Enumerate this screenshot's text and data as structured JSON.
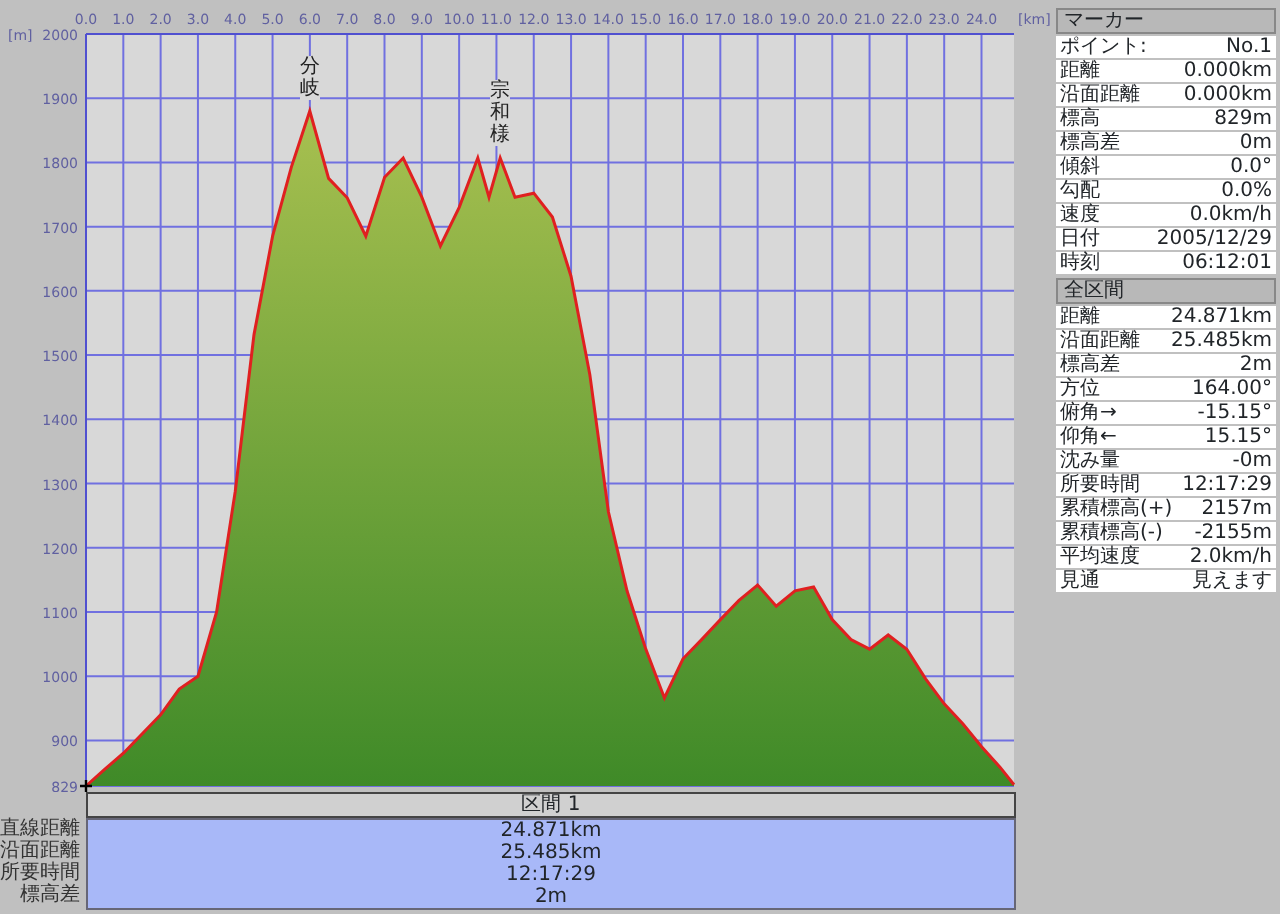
{
  "chart": {
    "y_unit": "[m]",
    "x_unit": "[km]",
    "chart_data": {
      "type": "area",
      "x": [
        0,
        0.5,
        1,
        1.5,
        2,
        2.5,
        3,
        3.5,
        4,
        4.5,
        5,
        5.5,
        6,
        6.5,
        7,
        7.5,
        8,
        8.5,
        9,
        9.5,
        10,
        10.5,
        10.8,
        11.1,
        11.5,
        12,
        12.5,
        13,
        13.5,
        14,
        14.5,
        15,
        15.5,
        16,
        16.5,
        17,
        17.5,
        18,
        18.5,
        19,
        19.5,
        20,
        20.5,
        21,
        21.5,
        22,
        22.5,
        23,
        23.5,
        24,
        24.5,
        24.871
      ],
      "grid": true,
      "series": [
        {
          "color": "#e02020",
          "values": [
            829,
            855,
            880,
            910,
            940,
            980,
            1000,
            1100,
            1287,
            1532,
            1685,
            1792,
            1880,
            1775,
            1745,
            1685,
            1777,
            1807,
            1746,
            1670,
            1730,
            1807,
            1746,
            1807,
            1746,
            1752,
            1715,
            1623,
            1470,
            1256,
            1133,
            1043,
            966,
            1027,
            1057,
            1088,
            1118,
            1142,
            1109,
            1133,
            1139,
            1088,
            1057,
            1042,
            1064,
            1042,
            996,
            957,
            926,
            890,
            858,
            831
          ]
        }
      ],
      "xlim": [
        0,
        24.871
      ],
      "ylim": [
        829,
        2000
      ],
      "xticks": [
        {
          "value": 0,
          "label": "0.0"
        },
        {
          "value": 1,
          "label": "1.0"
        },
        {
          "value": 2,
          "label": "2.0"
        },
        {
          "value": 3,
          "label": "3.0"
        },
        {
          "value": 4,
          "label": "4.0"
        },
        {
          "value": 5,
          "label": "5.0"
        },
        {
          "value": 6,
          "label": "6.0"
        },
        {
          "value": 7,
          "label": "7.0"
        },
        {
          "value": 8,
          "label": "8.0"
        },
        {
          "value": 9,
          "label": "9.0"
        },
        {
          "value": 10,
          "label": "10.0"
        },
        {
          "value": 11,
          "label": "11.0"
        },
        {
          "value": 12,
          "label": "12.0"
        },
        {
          "value": 13,
          "label": "13.0"
        },
        {
          "value": 14,
          "label": "14.0"
        },
        {
          "value": 15,
          "label": "15.0"
        },
        {
          "value": 16,
          "label": "16.0"
        },
        {
          "value": 17,
          "label": "17.0"
        },
        {
          "value": 18,
          "label": "18.0"
        },
        {
          "value": 19,
          "label": "19.0"
        },
        {
          "value": 20,
          "label": "20.0"
        },
        {
          "value": 21,
          "label": "21.0"
        },
        {
          "value": 22,
          "label": "22.0"
        },
        {
          "value": 23,
          "label": "23.0"
        },
        {
          "value": 24,
          "label": "24.0"
        }
      ],
      "yticks": [
        829,
        900,
        1000,
        1100,
        1200,
        1300,
        1400,
        1500,
        1600,
        1700,
        1800,
        1900,
        2000
      ],
      "annotations": [
        {
          "x": 6,
          "y": 1880,
          "text": "分岐"
        },
        {
          "x": 11.1,
          "y": 1807,
          "text": "宗和様"
        }
      ]
    }
  },
  "marker_panel": {
    "title": "マーカー",
    "rows": [
      {
        "label": "ポイント:",
        "value": "No.1"
      },
      {
        "label": "距離",
        "value": "0.000km"
      },
      {
        "label": "沿面距離",
        "value": "0.000km"
      },
      {
        "label": "標高",
        "value": "829m"
      },
      {
        "label": "標高差",
        "value": "0m"
      },
      {
        "label": "傾斜",
        "value": "0.0°"
      },
      {
        "label": "勾配",
        "value": "0.0%"
      },
      {
        "label": "速度",
        "value": "0.0km/h"
      },
      {
        "label": "日付",
        "value": "2005/12/29"
      },
      {
        "label": "時刻",
        "value": "06:12:01"
      }
    ]
  },
  "total_panel": {
    "title": "全区間",
    "rows": [
      {
        "label": "距離",
        "value": "24.871km"
      },
      {
        "label": "沿面距離",
        "value": "25.485km"
      },
      {
        "label": "標高差",
        "value": "2m"
      },
      {
        "label": "方位",
        "value": "164.00°"
      },
      {
        "label": "俯角→",
        "value": "-15.15°"
      },
      {
        "label": "仰角←",
        "value": "15.15°"
      },
      {
        "label": "沈み量",
        "value": "-0m"
      },
      {
        "label": "所要時間",
        "value": "12:17:29"
      },
      {
        "label": "累積標高(+)",
        "value": "2157m"
      },
      {
        "label": "累積標高(-)",
        "value": "-2155m"
      },
      {
        "label": "平均速度",
        "value": "2.0km/h"
      },
      {
        "label": "見通",
        "value": "見えます"
      }
    ]
  },
  "sections": {
    "header": "区間 1",
    "rows": [
      {
        "label": "直線距離",
        "value": "24.871km"
      },
      {
        "label": "沿面距離",
        "value": "25.485km"
      },
      {
        "label": "所要時間",
        "value": "12:17:29"
      },
      {
        "label": "標高差",
        "value": "2m"
      }
    ]
  }
}
